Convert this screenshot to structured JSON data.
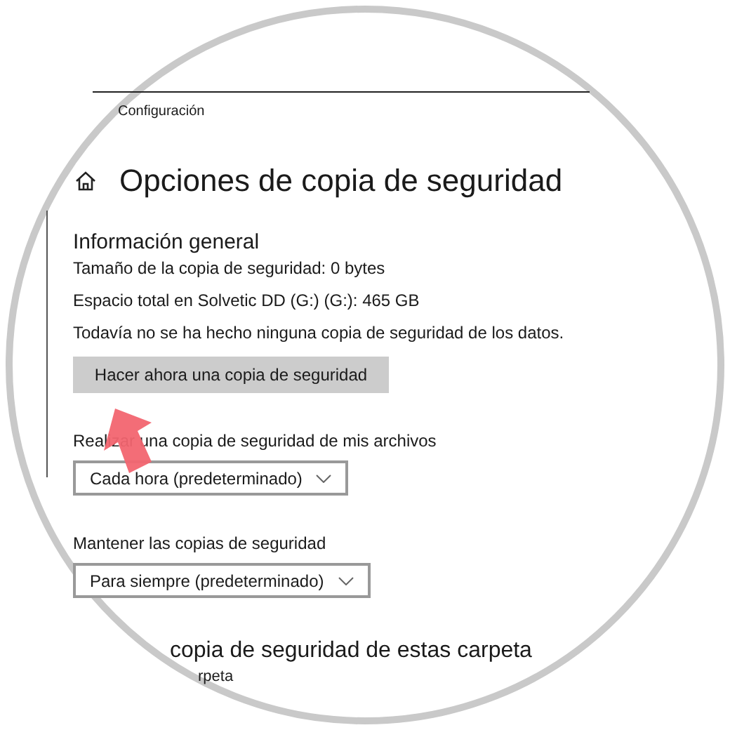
{
  "window": {
    "breadcrumb": "Configuración"
  },
  "page": {
    "title": "Opciones de copia de seguridad"
  },
  "overview": {
    "heading": "Información general",
    "lines": [
      "Tamaño de la copia de seguridad: 0 bytes",
      "Espacio total en Solvetic DD (G:) (G:): 465 GB",
      "Todavía no se ha hecho ninguna copia de seguridad de los datos."
    ],
    "button": "Hacer ahora una copia de seguridad"
  },
  "settings": [
    {
      "label": "Realizar una copia de seguridad de mis archivos",
      "value": "Cada hora (predeterminado)"
    },
    {
      "label": "Mantener las copias de seguridad",
      "value": "Para siempre (predeterminado)"
    }
  ],
  "folders": {
    "heading": "copia de seguridad de estas carpeta",
    "text": "rpeta"
  }
}
